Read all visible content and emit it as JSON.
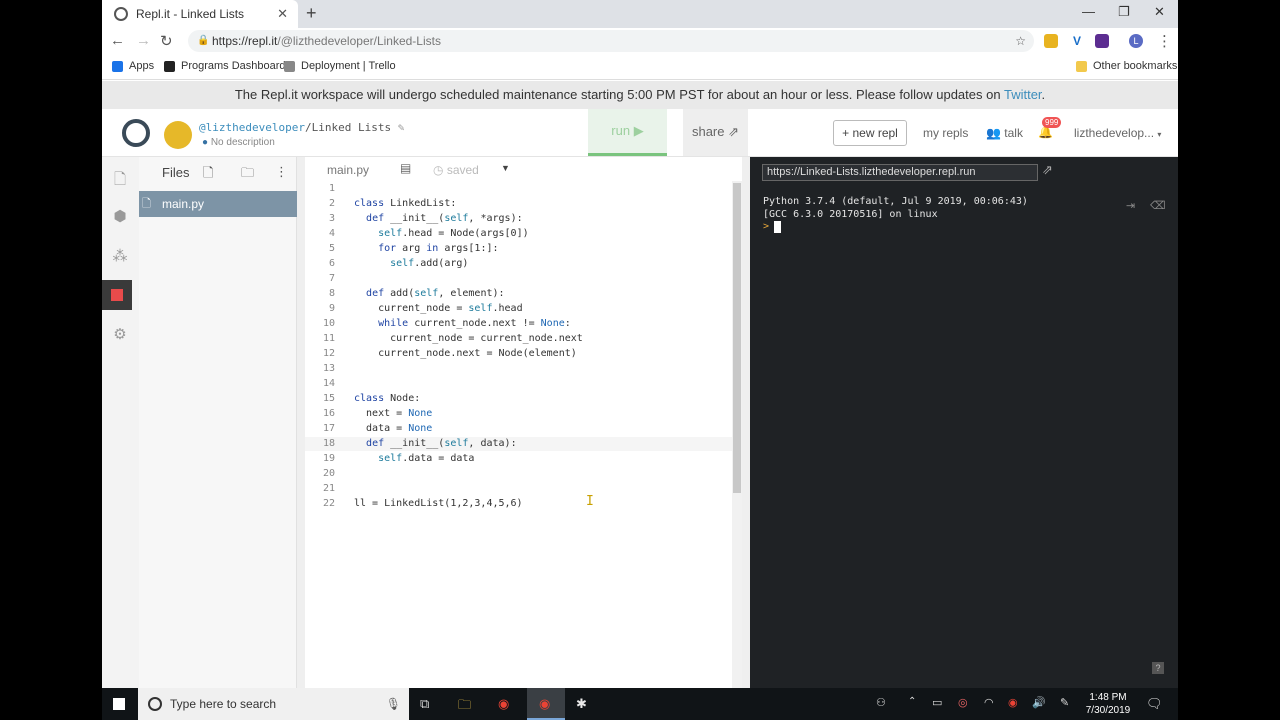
{
  "browser": {
    "tab_title": "Repl.it - Linked Lists",
    "url_host": "https://repl.it",
    "url_path": "/@lizthedeveloper/Linked-Lists",
    "bookmarks": [
      "Apps",
      "Programs Dashboard",
      "Deployment | Trello"
    ],
    "other_bookmarks": "Other bookmarks"
  },
  "banner": {
    "text": "The Repl.it workspace will undergo scheduled maintenance starting 5:00 PM PST for about an hour or less. Please follow updates on ",
    "link": "Twitter",
    "tail": "."
  },
  "header": {
    "user": "@lizthedeveloper",
    "repl": "/Linked Lists",
    "description": "No description",
    "run": "run ▶",
    "share": "share",
    "new_repl": "+ new repl",
    "my_repls": "my repls",
    "talk": "talk",
    "notif_count": "999",
    "username": "lizthedevelop..."
  },
  "files": {
    "title": "Files",
    "items": [
      "main.py"
    ]
  },
  "editor": {
    "tab": "main.py",
    "status": "saved",
    "lines": [
      "",
      "class LinkedList:",
      "  def __init__(self, *args):",
      "    self.head = Node(args[0])",
      "    for arg in args[1:]:",
      "      self.add(arg)",
      "",
      "  def add(self, element):",
      "    current_node = self.head",
      "    while current_node.next != None:",
      "      current_node = current_node.next",
      "    current_node.next = Node(element)",
      "",
      "",
      "class Node:",
      "  next = None",
      "  data = None",
      "  def __init__(self, data):",
      "    self.data = data",
      "",
      "",
      "ll = LinkedList(1,2,3,4,5,6)"
    ]
  },
  "console": {
    "url": "https://Linked-Lists.lizthedeveloper.repl.run",
    "line1": "Python 3.7.4 (default, Jul  9 2019, 00:06:43)",
    "line2": "[GCC 6.3.0 20170516] on linux",
    "prompt": ">"
  },
  "taskbar": {
    "search_placeholder": "Type here to search",
    "time": "1:48 PM",
    "date": "7/30/2019"
  }
}
